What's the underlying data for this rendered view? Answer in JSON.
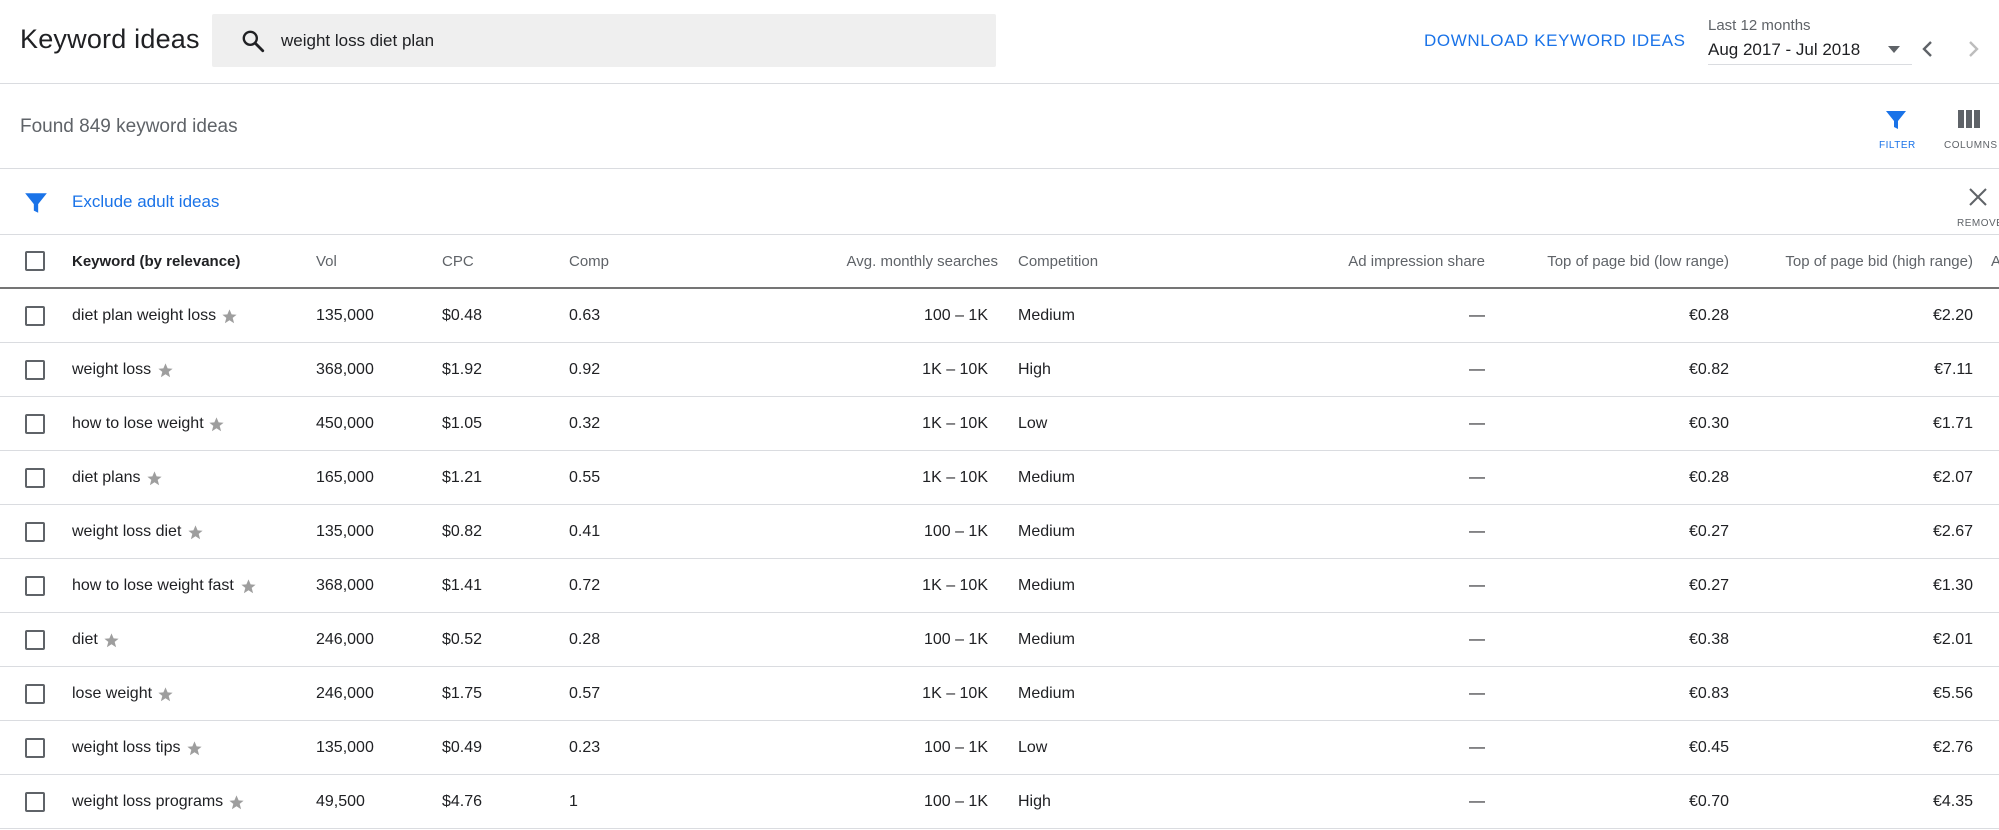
{
  "header": {
    "title": "Keyword ideas",
    "search_value": "weight loss diet plan",
    "download_label": "DOWNLOAD KEYWORD IDEAS",
    "date_caption": "Last 12 months",
    "date_range": "Aug 2017 - Jul 2018"
  },
  "summary": {
    "found_text": "Found 849 keyword ideas",
    "filter_label": "FILTER",
    "columns_label": "COLUMNS"
  },
  "filter_bar": {
    "text": "Exclude adult ideas",
    "remove_label": "REMOVE"
  },
  "table": {
    "columns": {
      "keyword": "Keyword (by relevance)",
      "vol": "Vol",
      "cpc": "CPC",
      "comp": "Comp",
      "avg": "Avg. monthly searches",
      "competition": "Competition",
      "ad_share": "Ad impression share",
      "bid_low": "Top of page bid (low range)",
      "bid_high": "Top of page bid (high range)",
      "cut_off": "A"
    },
    "rows": [
      {
        "keyword": "diet plan weight loss",
        "vol": "135,000",
        "cpc": "$0.48",
        "comp": "0.63",
        "avg": "100 – 1K",
        "competition": "Medium",
        "ad_share": "—",
        "bid_low": "€0.28",
        "bid_high": "€2.20"
      },
      {
        "keyword": "weight loss",
        "vol": "368,000",
        "cpc": "$1.92",
        "comp": "0.92",
        "avg": "1K – 10K",
        "competition": "High",
        "ad_share": "—",
        "bid_low": "€0.82",
        "bid_high": "€7.11"
      },
      {
        "keyword": "how to lose weight",
        "vol": "450,000",
        "cpc": "$1.05",
        "comp": "0.32",
        "avg": "1K – 10K",
        "competition": "Low",
        "ad_share": "—",
        "bid_low": "€0.30",
        "bid_high": "€1.71"
      },
      {
        "keyword": "diet plans",
        "vol": "165,000",
        "cpc": "$1.21",
        "comp": "0.55",
        "avg": "1K – 10K",
        "competition": "Medium",
        "ad_share": "—",
        "bid_low": "€0.28",
        "bid_high": "€2.07"
      },
      {
        "keyword": "weight loss diet",
        "vol": "135,000",
        "cpc": "$0.82",
        "comp": "0.41",
        "avg": "100 – 1K",
        "competition": "Medium",
        "ad_share": "—",
        "bid_low": "€0.27",
        "bid_high": "€2.67"
      },
      {
        "keyword": "how to lose weight fast",
        "vol": "368,000",
        "cpc": "$1.41",
        "comp": "0.72",
        "avg": "1K – 10K",
        "competition": "Medium",
        "ad_share": "—",
        "bid_low": "€0.27",
        "bid_high": "€1.30"
      },
      {
        "keyword": "diet",
        "vol": "246,000",
        "cpc": "$0.52",
        "comp": "0.28",
        "avg": "100 – 1K",
        "competition": "Medium",
        "ad_share": "—",
        "bid_low": "€0.38",
        "bid_high": "€2.01"
      },
      {
        "keyword": "lose weight",
        "vol": "246,000",
        "cpc": "$1.75",
        "comp": "0.57",
        "avg": "1K – 10K",
        "competition": "Medium",
        "ad_share": "—",
        "bid_low": "€0.83",
        "bid_high": "€5.56"
      },
      {
        "keyword": "weight loss tips",
        "vol": "135,000",
        "cpc": "$0.49",
        "comp": "0.23",
        "avg": "100 – 1K",
        "competition": "Low",
        "ad_share": "—",
        "bid_low": "€0.45",
        "bid_high": "€2.76"
      },
      {
        "keyword": "weight loss programs",
        "vol": "49,500",
        "cpc": "$4.76",
        "comp": "1",
        "avg": "100 – 1K",
        "competition": "High",
        "ad_share": "—",
        "bid_low": "€0.70",
        "bid_high": "€4.35"
      }
    ]
  },
  "colors": {
    "accent": "#1a73e8",
    "star": "#9e9e9e"
  },
  "icons": [
    "search-icon",
    "chevron-down-icon",
    "chevron-left-icon",
    "chevron-right-icon",
    "filter-icon",
    "columns-icon",
    "close-icon",
    "star-icon",
    "checkbox-icon"
  ]
}
